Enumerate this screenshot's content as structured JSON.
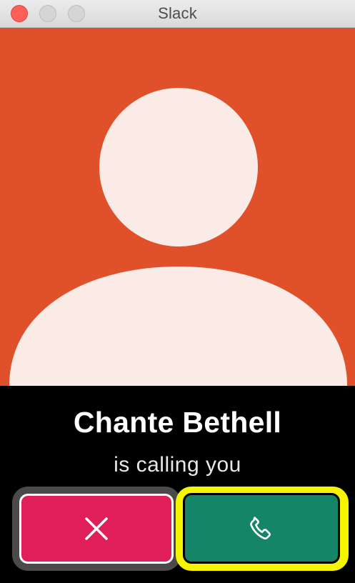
{
  "window": {
    "title": "Slack"
  },
  "caller": {
    "name": "Chante Bethell",
    "status": "is calling you",
    "avatar_background": "#e0512b",
    "avatar_silhouette": "#fbebe6"
  },
  "actions": {
    "decline": {
      "icon": "close-icon",
      "color": "#e01e5a"
    },
    "accept": {
      "icon": "phone-icon",
      "color": "#148567",
      "highlight": "#f5f500"
    }
  }
}
